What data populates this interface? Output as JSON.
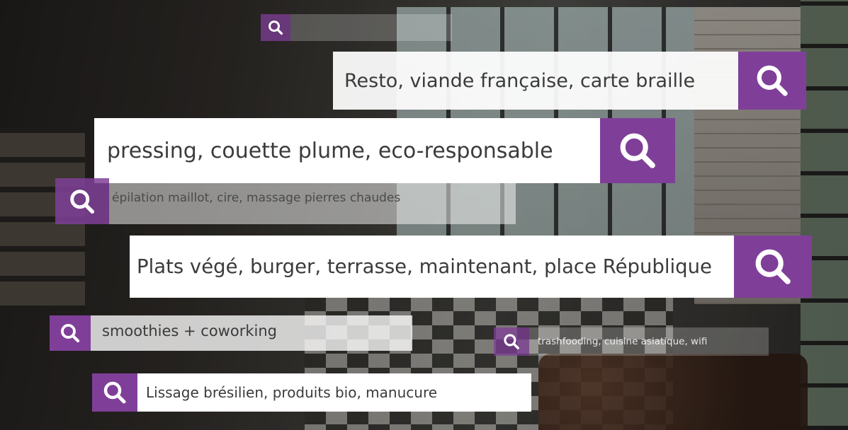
{
  "theme": {
    "accent": "#7f3f98"
  },
  "search_bars": [
    {
      "id": "top-empty",
      "value": ""
    },
    {
      "id": "resto",
      "value": "Resto, viande française, carte braille"
    },
    {
      "id": "pressing",
      "value": "pressing, couette plume, eco-responsable"
    },
    {
      "id": "epilation",
      "value": "épilation maillot, cire, massage pierres chaudes"
    },
    {
      "id": "plats",
      "value": "Plats végé, burger, terrasse, maintenant, place République"
    },
    {
      "id": "smoothies",
      "value": "smoothies + coworking"
    },
    {
      "id": "trashfooding",
      "value": "trashfooding, cuisine asiatique, wifi"
    },
    {
      "id": "lissage",
      "value": "Lissage brésilien, produits bio, manucure"
    }
  ],
  "icons": {
    "search": "search-icon"
  }
}
